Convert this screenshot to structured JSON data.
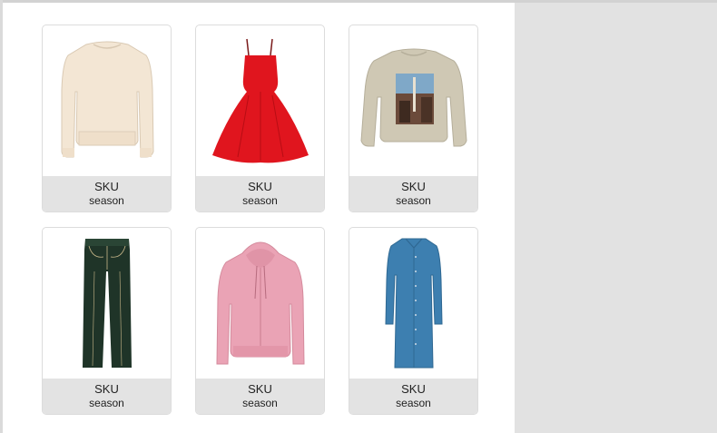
{
  "products": [
    {
      "sku": "SKU",
      "season": "season",
      "image_icon": "cream-sweatshirt-icon",
      "color": "#f3e6d4"
    },
    {
      "sku": "SKU",
      "season": "season",
      "image_icon": "red-dress-icon",
      "color": "#e0151e"
    },
    {
      "sku": "SKU",
      "season": "season",
      "image_icon": "beige-graphic-sweatshirt-icon",
      "color": "#cfc8b4"
    },
    {
      "sku": "SKU",
      "season": "season",
      "image_icon": "dark-green-jeans-icon",
      "color": "#1f3428"
    },
    {
      "sku": "SKU",
      "season": "season",
      "image_icon": "pink-hoodie-icon",
      "color": "#eaa3b5"
    },
    {
      "sku": "SKU",
      "season": "season",
      "image_icon": "blue-denim-dress-icon",
      "color": "#3d7fb0"
    }
  ]
}
